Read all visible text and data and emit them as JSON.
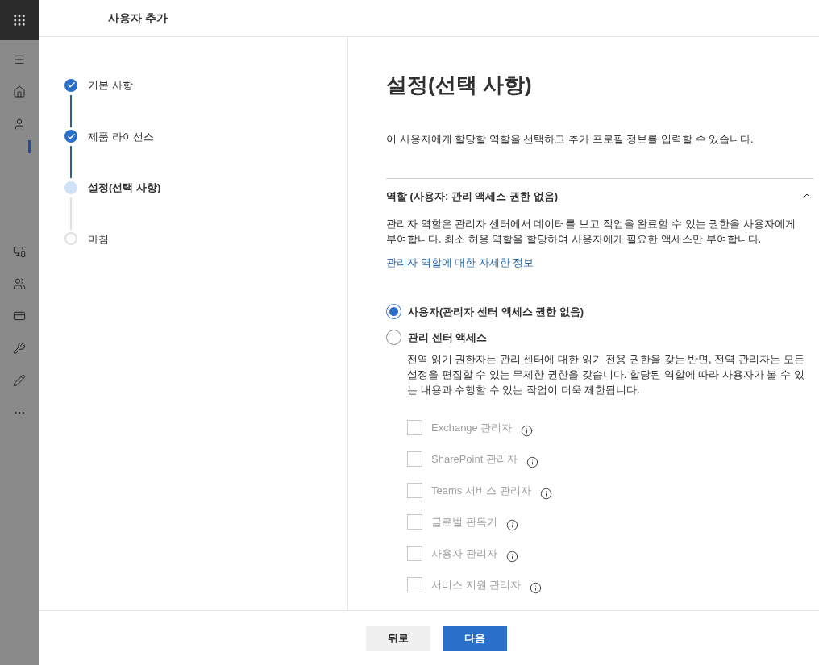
{
  "header": {
    "title": "사용자 추가"
  },
  "steps": [
    {
      "label": "기본 사항",
      "kind": "done"
    },
    {
      "label": "제품 라이선스",
      "kind": "done"
    },
    {
      "label": "설정(선택 사항)",
      "kind": "current"
    },
    {
      "label": "마침",
      "kind": "pending"
    }
  ],
  "content": {
    "heading": "설정(선택 사항)",
    "intro": "이 사용자에게 할당할 역할을 선택하고 추가 프로필 정보를 입력할 수 있습니다.",
    "section": {
      "title": "역할 (사용자: 관리 액세스 권한 없음)",
      "expanded": true,
      "description": "관리자 역할은 관리자 센터에서 데이터를 보고 작업을 완료할 수 있는 권한을 사용자에게 부여합니다. 최소 허용 역할을 할당하여 사용자에게 필요한 액세스만 부여합니다.",
      "link": "관리자 역할에 대한 자세한 정보",
      "options": [
        {
          "label": "사용자(관리자 센터 액세스 권한 없음)",
          "selected": true
        },
        {
          "label": "관리 센터 액세스",
          "selected": false,
          "description": "전역 읽기 권한자는 관리 센터에 대한 읽기 전용 권한을 갖는 반면, 전역 관리자는 모든 설정을 편집할 수 있는 무제한 권한을 갖습니다. 할당된 역할에 따라 사용자가 볼 수 있는 내용과 수행할 수 있는 작업이 더욱 제한됩니다."
        }
      ],
      "roles": [
        {
          "label": "Exchange 관리자",
          "checked": false,
          "disabled": true
        },
        {
          "label": "SharePoint 관리자",
          "checked": false,
          "disabled": true
        },
        {
          "label": "Teams 서비스 관리자",
          "checked": false,
          "disabled": true
        },
        {
          "label": "글로벌 판독기",
          "checked": false,
          "disabled": true
        },
        {
          "label": "사용자 관리자",
          "checked": false,
          "disabled": true
        },
        {
          "label": "서비스 지원 관리자",
          "checked": false,
          "disabled": true
        }
      ]
    }
  },
  "footer": {
    "buttons": [
      {
        "label": "뒤로",
        "kind": "secondary"
      },
      {
        "label": "다음",
        "kind": "primary"
      }
    ]
  }
}
